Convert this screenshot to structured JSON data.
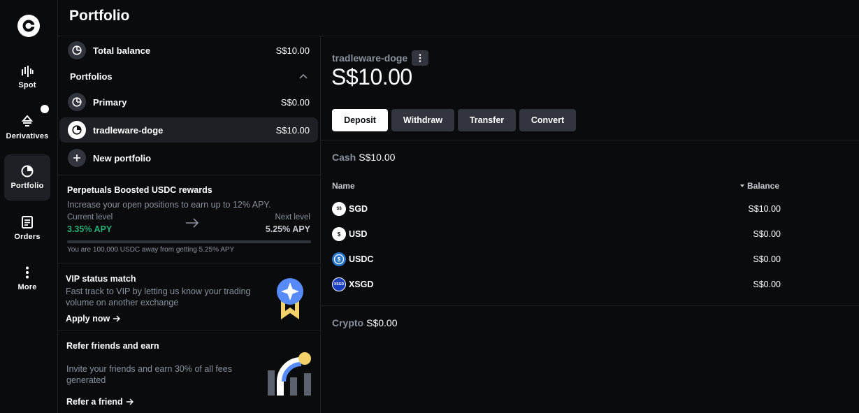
{
  "header": {
    "title": "Portfolio"
  },
  "nav": {
    "items": [
      {
        "label": "Spot",
        "icon": "candlestick-icon"
      },
      {
        "label": "Derivatives",
        "icon": "derivatives-icon"
      },
      {
        "label": "Portfolio",
        "icon": "pie-chart-icon",
        "active": true
      },
      {
        "label": "Orders",
        "icon": "orders-icon"
      },
      {
        "label": "More",
        "icon": "more-vertical-icon"
      }
    ]
  },
  "sidebar": {
    "total_label": "Total balance",
    "total_value": "S$10.00",
    "portfolios_label": "Portfolios",
    "portfolios": [
      {
        "name": "Primary",
        "value": "S$0.00",
        "selected": false
      },
      {
        "name": "tradleware-doge",
        "value": "S$10.00",
        "selected": true
      }
    ],
    "new_portfolio_label": "New portfolio"
  },
  "promo_perps": {
    "title": "Perpetuals Boosted USDC rewards",
    "subtitle": "Increase your open positions to earn up to 12% APY.",
    "current_label": "Current level",
    "current_value": "3.35% APY",
    "next_label": "Next level",
    "next_value": "5.25% APY",
    "progress": 0,
    "footnote": "You are 100,000 USDC away from getting 5.25% APY"
  },
  "promo_vip": {
    "title": "VIP status match",
    "subtitle": "Fast track to VIP by letting us know your trading volume on another exchange",
    "cta": "Apply now"
  },
  "promo_refer": {
    "title": "Refer friends and earn",
    "subtitle": "Invite your friends and earn 30% of all fees generated",
    "cta": "Refer a friend"
  },
  "account": {
    "name": "tradleware-doge",
    "balance": "S$10.00",
    "actions": [
      "Deposit",
      "Withdraw",
      "Transfer",
      "Convert"
    ]
  },
  "cash": {
    "label": "Cash",
    "value": "S$10.00",
    "columns": {
      "name": "Name",
      "balance": "Balance"
    },
    "rows": [
      {
        "name": "SGD",
        "balance": "S$10.00",
        "icon": "sgd-coin-icon"
      },
      {
        "name": "USD",
        "balance": "S$0.00",
        "icon": "usd-coin-icon"
      },
      {
        "name": "USDC",
        "balance": "S$0.00",
        "icon": "usdc-coin-icon"
      },
      {
        "name": "XSGD",
        "balance": "S$0.00",
        "icon": "xsgd-coin-icon"
      }
    ]
  },
  "crypto": {
    "label": "Crypto",
    "value": "S$0.00"
  },
  "colors": {
    "background": "#0a0b0d",
    "surface": "#1e2025",
    "muted_text": "#8a919e",
    "positive": "#27ad75",
    "brand_blue": "#578bfa",
    "gold": "#f2d16b"
  }
}
